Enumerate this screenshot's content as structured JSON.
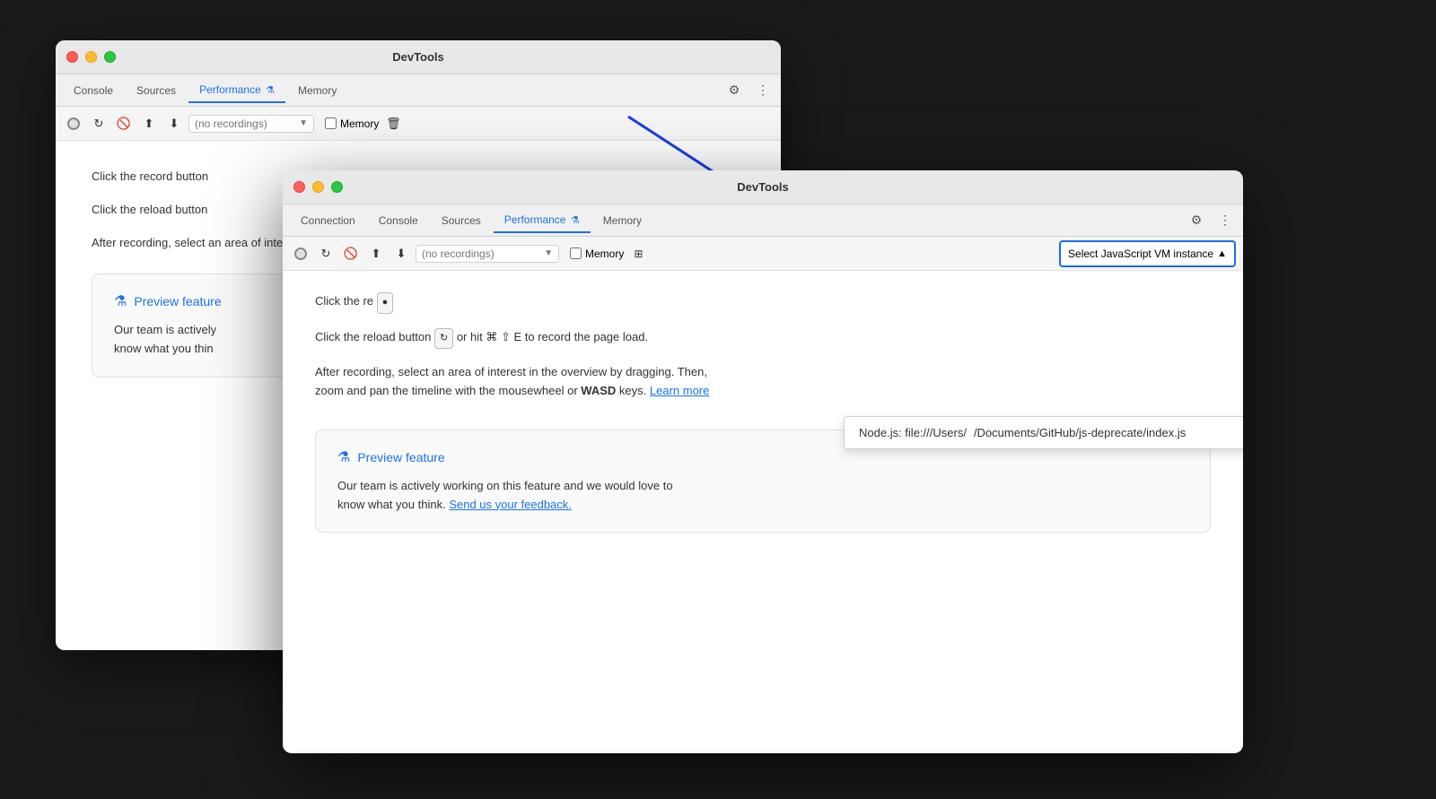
{
  "bg_window": {
    "title": "DevTools",
    "tabs": [
      {
        "label": "Console",
        "active": false
      },
      {
        "label": "Sources",
        "active": false
      },
      {
        "label": "Performance",
        "active": true
      },
      {
        "label": "Memory",
        "active": false
      }
    ],
    "toolbar": {
      "recordings_placeholder": "no recordings",
      "memory_label": "Memory"
    },
    "content": {
      "line1": "Click the record button",
      "line2": "Click the reload button",
      "line3": "After recording, select an area of interest in the overview by dragging. Then, zoom and pan the tim",
      "preview_title": "Preview feature",
      "preview_text": "Our team is actively",
      "preview_text2": "know what you thin"
    }
  },
  "fg_window": {
    "title": "DevTools",
    "tabs": [
      {
        "label": "Connection",
        "active": false
      },
      {
        "label": "Console",
        "active": false
      },
      {
        "label": "Sources",
        "active": false
      },
      {
        "label": "Performance",
        "active": true
      },
      {
        "label": "Memory",
        "active": false
      }
    ],
    "toolbar": {
      "recordings_placeholder": "no recordings",
      "memory_label": "Memory"
    },
    "vm_selector": {
      "label": "Select JavaScript VM instance",
      "arrow": "▲"
    },
    "dropdown": {
      "items": [
        {
          "label_start": "Node.js: file:///Users/",
          "label_end": "/Documents/GitHub/js-deprecate/index.js"
        }
      ]
    },
    "content": {
      "record_instruction": "Click the re",
      "reload_instruction": "Click the reload button",
      "reload_shortcut": "or hit ⌘ ⇧ E to record the page load.",
      "after_recording": "After recording, select an area of interest in the overview by dragging. Then,",
      "after_recording2": "zoom and pan the timeline with the mousewheel or",
      "after_recording_bold": "WASD",
      "after_recording3": "keys.",
      "learn_more": "Learn more",
      "preview_title": "Preview feature",
      "preview_text": "Our team is actively working on this feature and we would love to",
      "preview_text2": "know what you think.",
      "feedback_link": "Send us your feedback."
    }
  }
}
